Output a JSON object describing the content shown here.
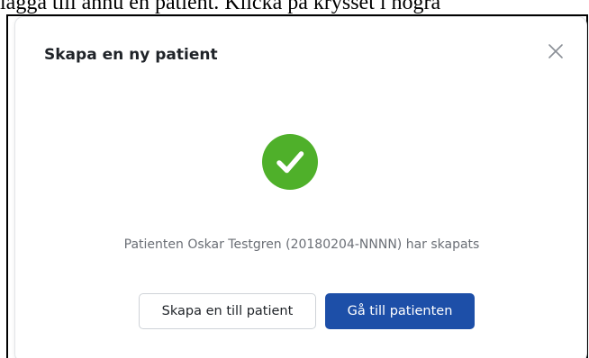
{
  "document": {
    "text_above": "lägga till ännu en patient. Klicka på krysset i högra"
  },
  "modal": {
    "title": "Skapa en ny patient",
    "close_icon": "close-icon",
    "status_icon": "check-circle-icon",
    "message": "Patienten Oskar Testgren (20180204-NNNN) har skapats",
    "buttons": {
      "secondary_label": "Skapa en till patient",
      "primary_label": "Gå till patienten"
    }
  },
  "colors": {
    "success_green": "#4fb02a",
    "primary_blue": "#1d4fa8",
    "close_gray": "#8a8f96"
  }
}
